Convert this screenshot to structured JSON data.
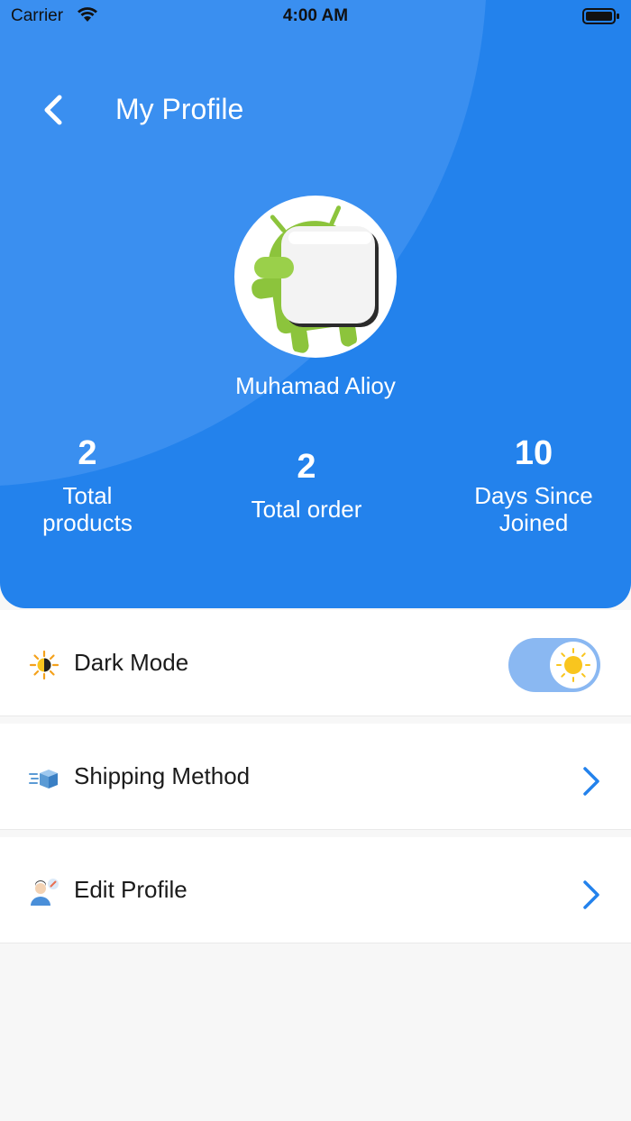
{
  "statusbar": {
    "carrier": "Carrier",
    "time": "4:00 AM"
  },
  "header": {
    "title": "My Profile",
    "user_name": "Muhamad Alioy"
  },
  "stats": [
    {
      "value": "2",
      "label": "Total products"
    },
    {
      "value": "2",
      "label": "Total order"
    },
    {
      "value": "10",
      "label": "Days Since Joined"
    }
  ],
  "settings": {
    "dark_mode": {
      "label": "Dark Mode",
      "enabled": false
    },
    "shipping": {
      "label": "Shipping Method"
    },
    "edit_profile": {
      "label": "Edit Profile"
    }
  },
  "colors": {
    "primary": "#2382EC",
    "toggle_track": "#8AB8F2",
    "sun": "#F9C51E",
    "chevron": "#2382EC"
  },
  "icons": {
    "back": "chevron-left-icon",
    "dark_mode": "sun-icon",
    "shipping": "shipping-box-icon",
    "edit_profile": "user-edit-icon",
    "chevron": "chevron-right-icon"
  }
}
